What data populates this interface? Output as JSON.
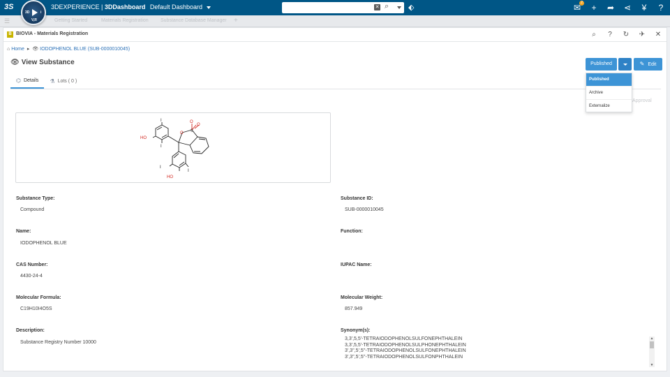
{
  "topbar": {
    "brand_logo": "3S",
    "compass": {
      "label_3d": "3D",
      "label_i": "i",
      "label_vr": "V,R"
    },
    "app_prefix": "3DEXPERIENCE",
    "app_name": "3DDashboard",
    "dashboard_name": "Default Dashboard",
    "search": {
      "value": "",
      "placeholder": ""
    },
    "notification_count": "2",
    "icons": [
      "share-tag-icon",
      "notification-icon",
      "add-icon",
      "share-icon",
      "network-icon",
      "compass-apps-icon",
      "help-icon"
    ]
  },
  "dashboard_tabs": {
    "items": [
      "Getting Started",
      "Materials Registration",
      "Substance Database Manager"
    ]
  },
  "widget": {
    "logo_text": "B",
    "title": "BIOVIA - Materials Registration",
    "breadcrumb": {
      "home": "Home",
      "current": "IODOPHENOL BLUE (SUB-0000010045)"
    },
    "heading": "View Substance",
    "buttons": {
      "published": "Published",
      "edit": "Edit"
    },
    "status_menu": {
      "items": [
        "Published",
        "Archive",
        "Externalize"
      ],
      "selected": "Published"
    },
    "ghost_text": "Approval",
    "tabs": [
      {
        "label": "Details",
        "active": true
      },
      {
        "label": "Lots ( 0 )",
        "active": false
      }
    ],
    "structure": {
      "atoms": {
        "ho_top": "HO",
        "i1": "I",
        "i2": "I",
        "o_ring": "O",
        "s": "S",
        "o1": "O",
        "o2": "O",
        "i3": "I",
        "i4": "I",
        "ho_bottom": "HO"
      }
    },
    "fields": {
      "substance_type": {
        "label": "Substance Type:",
        "value": "Compound"
      },
      "substance_id": {
        "label": "Substance ID:",
        "value": "SUB-0000010045"
      },
      "name": {
        "label": "Name:",
        "value": "IODOPHENOL BLUE"
      },
      "function": {
        "label": "Function:",
        "value": ""
      },
      "cas_number": {
        "label": "CAS Number:",
        "value": "4430-24-4"
      },
      "iupac_name": {
        "label": "IUPAC Name:",
        "value": ""
      },
      "molecular_formula": {
        "label": "Molecular Formula:",
        "value": "C19H10I4O5S"
      },
      "molecular_weight": {
        "label": "Molecular Weight:",
        "value": "857.949"
      },
      "description": {
        "label": "Description:",
        "value": "Substance Registry Number 10000"
      },
      "synonyms": {
        "label": "Synonym(s):",
        "values": [
          "3,3',5,5'-TETRAIODOPHENOLSULFONEPHTHALEIN",
          "3,3',5,5'-TETRAIODOPHENOLSULPHONEPHTHALEIN",
          "3',3'',5',5''-TETRAIODOPHENOLSULFONEPHTHALEIN",
          "3',3'',5',5''-TETRAIODOPHENOLSULFONPHTHALEIN"
        ]
      }
    }
  },
  "colors": {
    "topbar": "#005686",
    "accent": "#3d94d6",
    "link": "#2d72b8",
    "heteroatom_oxygen": "#d2261e"
  }
}
